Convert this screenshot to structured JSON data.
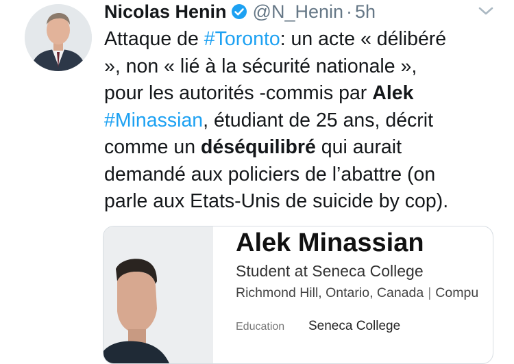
{
  "author": {
    "display_name": "Nicolas Henin",
    "handle": "@N_Henin",
    "separator": "·",
    "time": "5h",
    "verified": true
  },
  "tweet": {
    "lines": [
      [
        {
          "t": "text",
          "v": "Attaque de "
        },
        {
          "t": "hashtag",
          "v": "#Toronto"
        },
        {
          "t": "text",
          "v": ": un acte « délibéré"
        }
      ],
      [
        {
          "t": "text",
          "v": "», non « lié à la sécurité nationale »,"
        }
      ],
      [
        {
          "t": "text",
          "v": "pour les autorités -commis par "
        },
        {
          "t": "bold",
          "v": "Alek"
        }
      ],
      [
        {
          "t": "hashtag",
          "v": "#Minassian"
        },
        {
          "t": "text",
          "v": ", étudiant de 25 ans, décrit"
        }
      ],
      [
        {
          "t": "text",
          "v": "comme un "
        },
        {
          "t": "bold",
          "v": "déséquilibré"
        },
        {
          "t": "text",
          "v": " qui aurait"
        }
      ],
      [
        {
          "t": "text",
          "v": "demandé aux policiers de l’abattre (on"
        }
      ],
      [
        {
          "t": "text",
          "v": "parle aux Etats-Unis de suicide by cop)."
        }
      ]
    ]
  },
  "card": {
    "name": "Alek Minassian",
    "title": "Student at Seneca College",
    "location": "Richmond Hill, Ontario, Canada",
    "separator": "|",
    "industry": "Compu",
    "education_label": "Education",
    "education_value": "Seneca College"
  },
  "colors": {
    "link": "#1da1f2",
    "muted": "#657786",
    "verified_badge": "#1da1f2"
  },
  "icons": {
    "verified": "verified-badge-icon",
    "more": "chevron-down-icon"
  }
}
